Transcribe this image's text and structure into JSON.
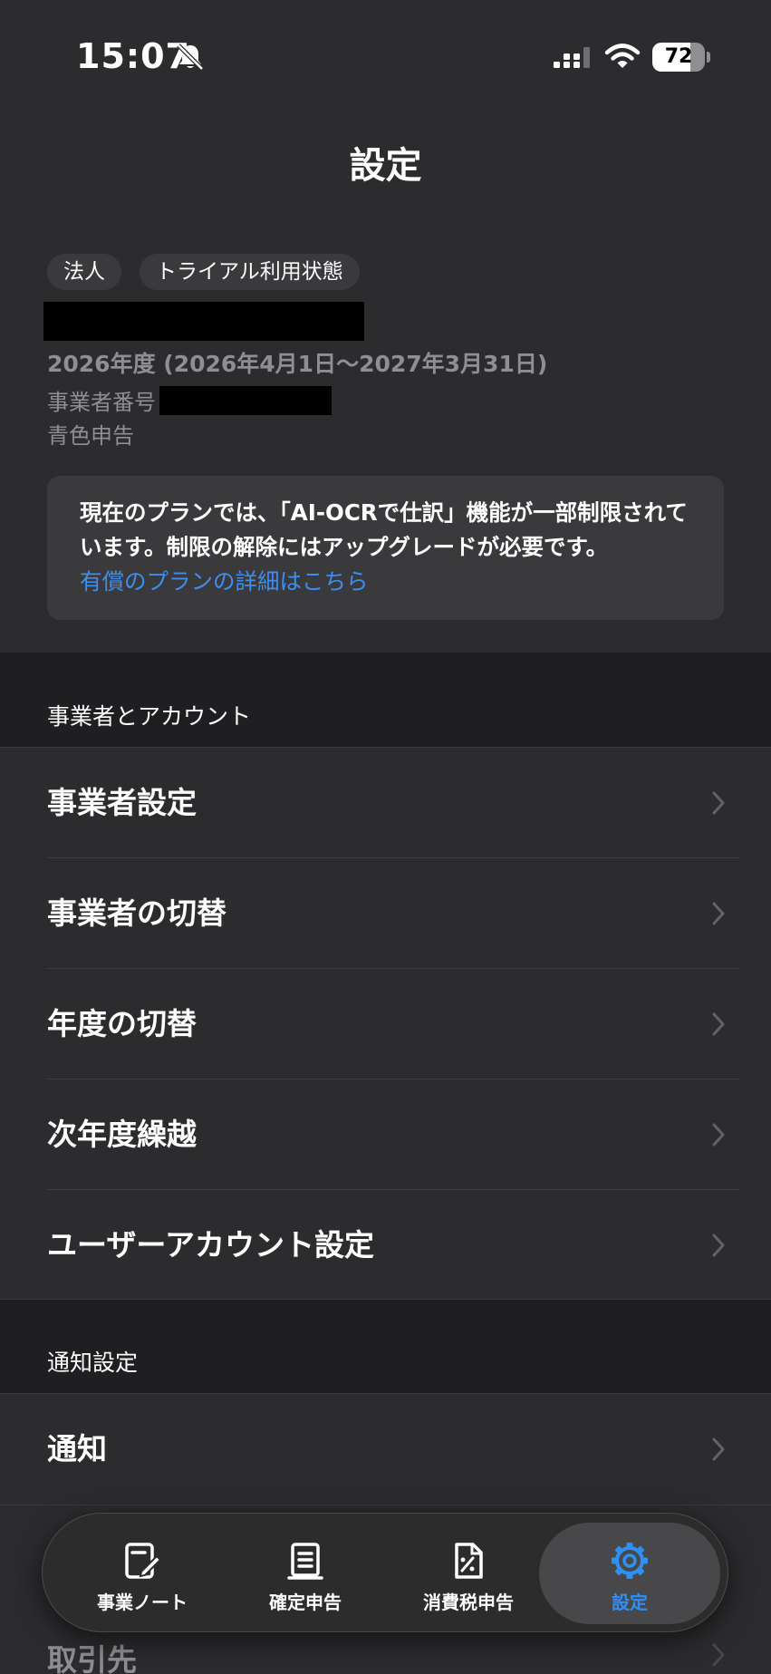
{
  "status_bar": {
    "time": "15:07",
    "battery_level": "72",
    "battery_fraction": 0.72
  },
  "nav": {
    "title": "設定"
  },
  "account": {
    "chips": [
      "法人",
      "トライアル利用状態"
    ],
    "fiscal_year": "2026年度 (2026年4月1日〜2027年3月31日)",
    "business_number_label": "事業者番号",
    "tax_filing_type": "青色申告"
  },
  "plan_notice": {
    "text": "現在のプランでは、「AI-OCRで仕訳」機能が一部制限されています。制限の解除にはアップグレードが必要です。",
    "link": "有償のプランの詳細はこちら"
  },
  "sections": [
    {
      "header": "事業者とアカウント",
      "items": [
        "事業者設定",
        "事業者の切替",
        "年度の切替",
        "次年度繰越",
        "ユーザーアカウント設定"
      ]
    },
    {
      "header": "通知設定",
      "items": [
        "通知"
      ]
    }
  ],
  "peek_item": "取引先",
  "tab_bar": {
    "tabs": [
      {
        "label": "事業ノート",
        "icon": "note-edit-icon",
        "active": false
      },
      {
        "label": "確定申告",
        "icon": "document-icon",
        "active": false
      },
      {
        "label": "消費税申告",
        "icon": "percent-document-icon",
        "active": false
      },
      {
        "label": "設定",
        "icon": "gear-icon",
        "active": true
      }
    ]
  },
  "colors": {
    "background": "#2c2c2e",
    "section_header_bg": "#1f1f21",
    "accent_blue": "#2f8ff5",
    "link_blue": "#3d8ef0",
    "secondary_text": "#8e8e93"
  }
}
